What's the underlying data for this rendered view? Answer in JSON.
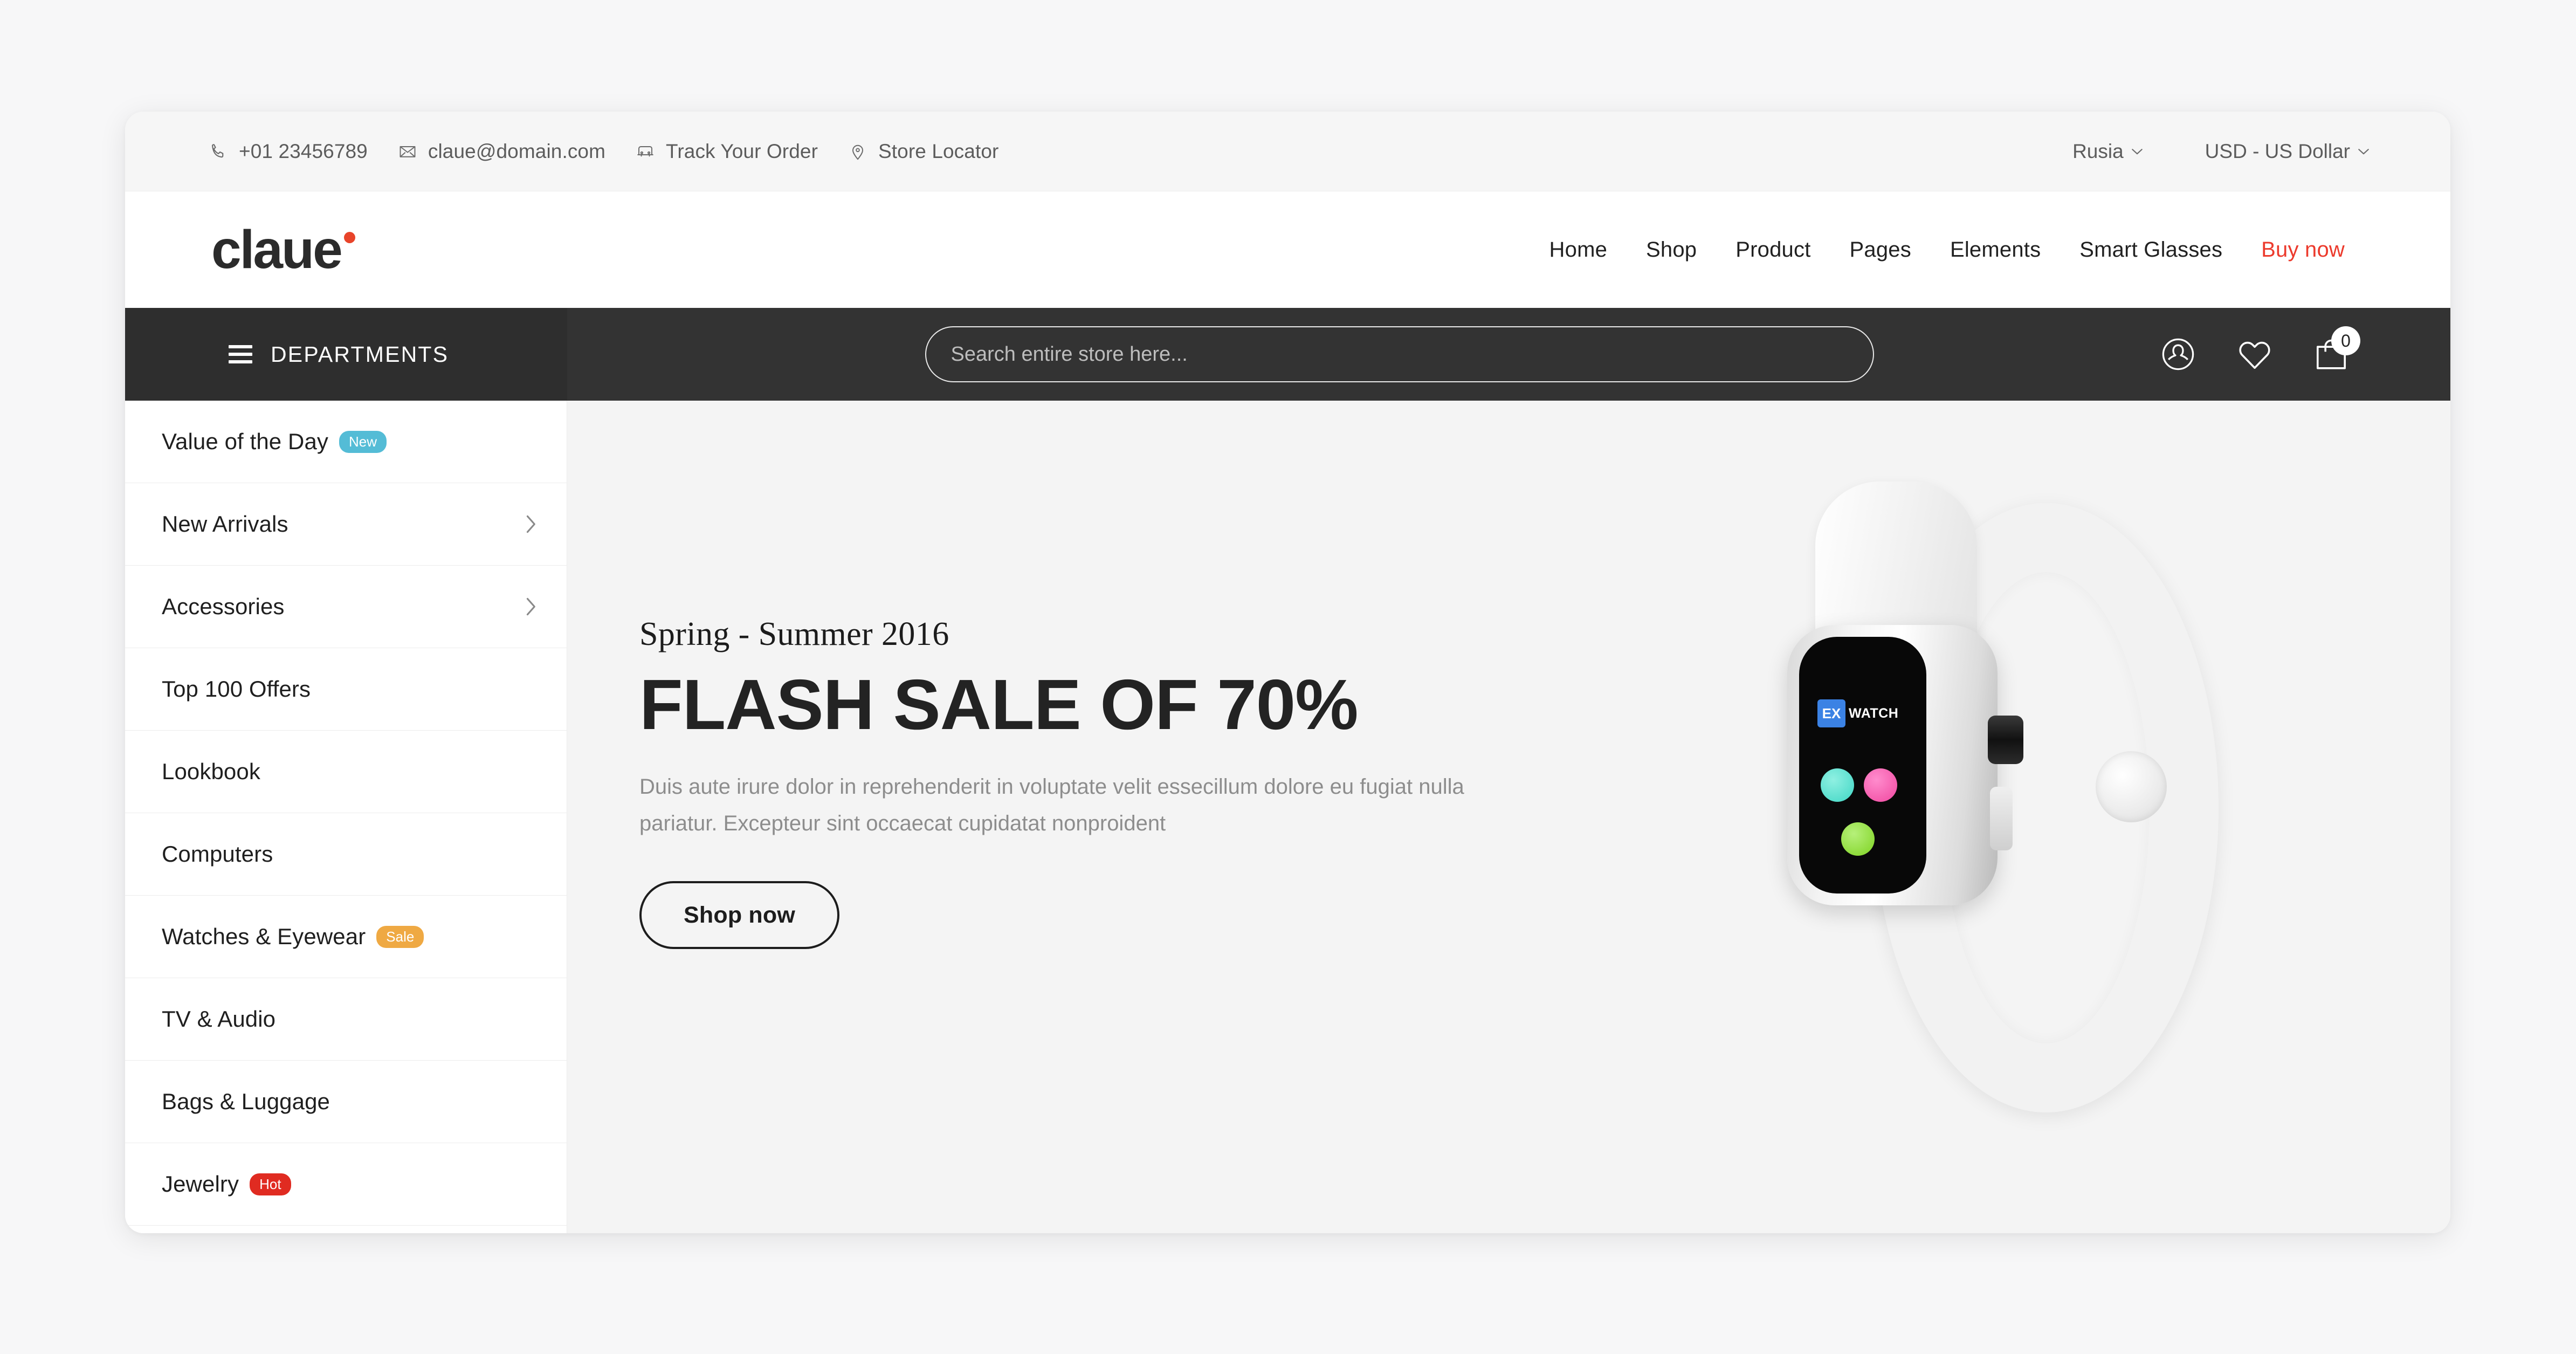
{
  "topbar": {
    "phone": "+01 23456789",
    "email": "claue@domain.com",
    "track_order": "Track Your Order",
    "store_locator": "Store Locator",
    "language": "Rusia",
    "currency": "USD - US Dollar"
  },
  "header": {
    "logo_text": "claue",
    "nav": [
      {
        "label": "Home",
        "accent": false
      },
      {
        "label": "Shop",
        "accent": false
      },
      {
        "label": "Product",
        "accent": false
      },
      {
        "label": "Pages",
        "accent": false
      },
      {
        "label": "Elements",
        "accent": false
      },
      {
        "label": "Smart Glasses",
        "accent": false
      },
      {
        "label": "Buy now",
        "accent": true
      }
    ]
  },
  "darkbar": {
    "departments_label": "DEPARTMENTS",
    "search_placeholder": "Search entire store here...",
    "search_value": "",
    "cart_count": "0"
  },
  "sidebar": {
    "items": [
      {
        "label": "Value of the Day",
        "badge": "New",
        "badge_color": "#54bcd6",
        "chevron": false
      },
      {
        "label": "New Arrivals",
        "badge": "",
        "badge_color": "",
        "chevron": true
      },
      {
        "label": "Accessories",
        "badge": "",
        "badge_color": "",
        "chevron": true
      },
      {
        "label": "Top 100 Offers",
        "badge": "",
        "badge_color": "",
        "chevron": false
      },
      {
        "label": "Lookbook",
        "badge": "",
        "badge_color": "",
        "chevron": false
      },
      {
        "label": "Computers",
        "badge": "",
        "badge_color": "",
        "chevron": false
      },
      {
        "label": "Watches & Eyewear",
        "badge": "Sale",
        "badge_color": "#efa943",
        "chevron": false
      },
      {
        "label": "TV & Audio",
        "badge": "",
        "badge_color": "",
        "chevron": false
      },
      {
        "label": "Bags & Luggage",
        "badge": "",
        "badge_color": "",
        "chevron": false
      },
      {
        "label": "Jewelry",
        "badge": "Hot",
        "badge_color": "#e02b21",
        "chevron": false
      }
    ]
  },
  "hero": {
    "eyebrow": "Spring - Summer 2016",
    "title": "FLASH SALE OF 70%",
    "description": "Duis aute irure dolor in reprehenderit in voluptate velit essecillum dolore eu fugiat nulla pariatur. Excepteur sint occaecat cupidatat nonproident",
    "cta_label": "Shop now",
    "watch": {
      "screen_tile_text": "EX",
      "screen_word": "WATCH"
    }
  },
  "colors": {
    "accent_red": "#ec3a2c",
    "dark_bar": "#333333",
    "hero_bg": "#f4f4f4"
  }
}
